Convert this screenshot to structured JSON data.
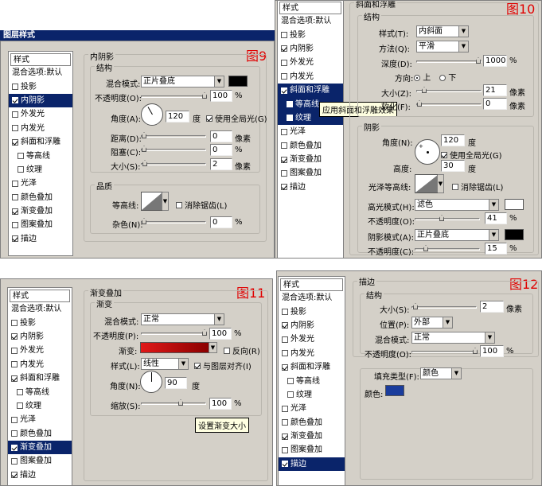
{
  "fig9": {
    "window_title": "图层样式",
    "figure_label": "图9",
    "side": {
      "header": "样式",
      "items": [
        {
          "label": "混合选项:默认",
          "cb": null,
          "on": false,
          "sub": false,
          "sel": false
        },
        {
          "label": "投影",
          "cb": true,
          "on": false,
          "sub": false,
          "sel": false
        },
        {
          "label": "内阴影",
          "cb": true,
          "on": true,
          "sub": false,
          "sel": true
        },
        {
          "label": "外发光",
          "cb": true,
          "on": false,
          "sub": false,
          "sel": false
        },
        {
          "label": "内发光",
          "cb": true,
          "on": false,
          "sub": false,
          "sel": false
        },
        {
          "label": "斜面和浮雕",
          "cb": true,
          "on": true,
          "sub": false,
          "sel": false
        },
        {
          "label": "等高线",
          "cb": true,
          "on": false,
          "sub": true,
          "sel": false
        },
        {
          "label": "纹理",
          "cb": true,
          "on": false,
          "sub": true,
          "sel": false
        },
        {
          "label": "光泽",
          "cb": true,
          "on": false,
          "sub": false,
          "sel": false
        },
        {
          "label": "颜色叠加",
          "cb": true,
          "on": false,
          "sub": false,
          "sel": false
        },
        {
          "label": "渐变叠加",
          "cb": true,
          "on": true,
          "sub": false,
          "sel": false
        },
        {
          "label": "图案叠加",
          "cb": true,
          "on": false,
          "sub": false,
          "sel": false
        },
        {
          "label": "描边",
          "cb": true,
          "on": true,
          "sub": false,
          "sel": false
        }
      ]
    },
    "section_title": "内阴影",
    "structure_title": "结构",
    "blend_mode_label": "混合模式:",
    "blend_mode_value": "正片叠底",
    "shadow_color": "#000000",
    "opacity_label": "不透明度(O):",
    "opacity_value": "100",
    "angle_label": "角度(A):",
    "angle_value": "120",
    "degree_unit": "度",
    "global_light_label": "使用全局光(G)",
    "distance_label": "距离(D):",
    "distance_value": "0",
    "choke_label": "阻塞(C):",
    "choke_value": "0",
    "size_label": "大小(S):",
    "size_value": "2",
    "px_unit": "像素",
    "pct_unit": "%",
    "quality_title": "品质",
    "contour_label": "等高线:",
    "antialias_label": "消除锯齿(L)",
    "noise_label": "杂色(N):",
    "noise_value": "0"
  },
  "fig10": {
    "figure_label": "图10",
    "section_title": "斜面和浮雕",
    "structure_title": "结构",
    "side": {
      "header": "样式",
      "items": [
        {
          "label": "混合选项:默认",
          "cb": null,
          "on": false,
          "sub": false,
          "sel": false
        },
        {
          "label": "投影",
          "cb": true,
          "on": false,
          "sub": false,
          "sel": false
        },
        {
          "label": "内阴影",
          "cb": true,
          "on": true,
          "sub": false,
          "sel": false
        },
        {
          "label": "外发光",
          "cb": true,
          "on": false,
          "sub": false,
          "sel": false
        },
        {
          "label": "内发光",
          "cb": true,
          "on": false,
          "sub": false,
          "sel": false
        },
        {
          "label": "斜面和浮雕",
          "cb": true,
          "on": true,
          "sub": false,
          "sel": true
        },
        {
          "label": "等高线",
          "cb": true,
          "on": false,
          "sub": true,
          "sel": true
        },
        {
          "label": "纹理",
          "cb": true,
          "on": false,
          "sub": true,
          "sel": true
        },
        {
          "label": "光泽",
          "cb": true,
          "on": false,
          "sub": false,
          "sel": false
        },
        {
          "label": "颜色叠加",
          "cb": true,
          "on": false,
          "sub": false,
          "sel": false
        },
        {
          "label": "渐变叠加",
          "cb": true,
          "on": true,
          "sub": false,
          "sel": false
        },
        {
          "label": "图案叠加",
          "cb": true,
          "on": false,
          "sub": false,
          "sel": false
        },
        {
          "label": "描边",
          "cb": true,
          "on": true,
          "sub": false,
          "sel": false
        }
      ]
    },
    "tooltip": "应用斜面和浮雕效果",
    "style_label": "样式(T):",
    "style_value": "内斜面",
    "technique_label": "方法(Q):",
    "technique_value": "平滑",
    "depth_label": "深度(D):",
    "depth_value": "1000",
    "direction_label": "方向:",
    "dir_up": "上",
    "dir_down": "下",
    "size_label": "大小(Z):",
    "size_value": "21",
    "soften_label": "软化(F):",
    "soften_value": "0",
    "px_unit": "像素",
    "pct_unit": "%",
    "shading_title": "阴影",
    "angle_label": "角度(N):",
    "angle_value": "120",
    "degree_unit": "度",
    "global_light_label": "使用全局光(G)",
    "altitude_label": "高度:",
    "altitude_value": "30",
    "gloss_label": "光泽等高线:",
    "antialias_label": "消除锯齿(L)",
    "highlight_label": "高光模式(H):",
    "highlight_value": "滤色",
    "highlight_color": "#ffffff",
    "hl_opacity_label": "不透明度(O):",
    "hl_opacity_value": "41",
    "shadow_mode_label": "阴影模式(A):",
    "shadow_mode_value": "正片叠底",
    "shadow_color": "#000000",
    "sh_opacity_label": "不透明度(C):",
    "sh_opacity_value": "15"
  },
  "fig11": {
    "figure_label": "图11",
    "section_title": "渐变叠加",
    "subsection_title": "渐变",
    "side": {
      "header": "样式",
      "items": [
        {
          "label": "混合选项:默认",
          "cb": null,
          "on": false,
          "sub": false,
          "sel": false
        },
        {
          "label": "投影",
          "cb": true,
          "on": false,
          "sub": false,
          "sel": false
        },
        {
          "label": "内阴影",
          "cb": true,
          "on": true,
          "sub": false,
          "sel": false
        },
        {
          "label": "外发光",
          "cb": true,
          "on": false,
          "sub": false,
          "sel": false
        },
        {
          "label": "内发光",
          "cb": true,
          "on": false,
          "sub": false,
          "sel": false
        },
        {
          "label": "斜面和浮雕",
          "cb": true,
          "on": true,
          "sub": false,
          "sel": false
        },
        {
          "label": "等高线",
          "cb": true,
          "on": false,
          "sub": true,
          "sel": false
        },
        {
          "label": "纹理",
          "cb": true,
          "on": false,
          "sub": true,
          "sel": false
        },
        {
          "label": "光泽",
          "cb": true,
          "on": false,
          "sub": false,
          "sel": false
        },
        {
          "label": "颜色叠加",
          "cb": true,
          "on": false,
          "sub": false,
          "sel": false
        },
        {
          "label": "渐变叠加",
          "cb": true,
          "on": true,
          "sub": false,
          "sel": true
        },
        {
          "label": "图案叠加",
          "cb": true,
          "on": false,
          "sub": false,
          "sel": false
        },
        {
          "label": "描边",
          "cb": true,
          "on": true,
          "sub": false,
          "sel": false
        }
      ]
    },
    "blend_mode_label": "混合模式:",
    "blend_mode_value": "正常",
    "opacity_label": "不透明度(P):",
    "opacity_value": "100",
    "gradient_label": "渐变:",
    "gradient_start": "#e01818",
    "gradient_end": "#8a0000",
    "reverse_label": "反向(R)",
    "style_label": "样式(L):",
    "style_value": "线性",
    "align_label": "与图层对齐(I)",
    "angle_label": "角度(N):",
    "angle_value": "90",
    "degree_unit": "度",
    "scale_label": "缩放(S):",
    "scale_value": "100",
    "pct_unit": "%",
    "tooltip": "设置渐变大小"
  },
  "fig12": {
    "figure_label": "图12",
    "section_title": "描边",
    "structure_title": "结构",
    "side": {
      "header": "样式",
      "items": [
        {
          "label": "混合选项:默认",
          "cb": null,
          "on": false,
          "sub": false,
          "sel": false
        },
        {
          "label": "投影",
          "cb": true,
          "on": false,
          "sub": false,
          "sel": false
        },
        {
          "label": "内阴影",
          "cb": true,
          "on": true,
          "sub": false,
          "sel": false
        },
        {
          "label": "外发光",
          "cb": true,
          "on": false,
          "sub": false,
          "sel": false
        },
        {
          "label": "内发光",
          "cb": true,
          "on": false,
          "sub": false,
          "sel": false
        },
        {
          "label": "斜面和浮雕",
          "cb": true,
          "on": true,
          "sub": false,
          "sel": false
        },
        {
          "label": "等高线",
          "cb": true,
          "on": false,
          "sub": true,
          "sel": false
        },
        {
          "label": "纹理",
          "cb": true,
          "on": false,
          "sub": true,
          "sel": false
        },
        {
          "label": "光泽",
          "cb": true,
          "on": false,
          "sub": false,
          "sel": false
        },
        {
          "label": "颜色叠加",
          "cb": true,
          "on": false,
          "sub": false,
          "sel": false
        },
        {
          "label": "渐变叠加",
          "cb": true,
          "on": true,
          "sub": false,
          "sel": false
        },
        {
          "label": "图案叠加",
          "cb": true,
          "on": false,
          "sub": false,
          "sel": false
        },
        {
          "label": "描边",
          "cb": true,
          "on": true,
          "sub": false,
          "sel": true
        }
      ]
    },
    "size_label": "大小(S):",
    "size_value": "2",
    "px_unit": "像素",
    "position_label": "位置(P):",
    "position_value": "外部",
    "blend_mode_label": "混合模式:",
    "blend_mode_value": "正常",
    "opacity_label": "不透明度(O):",
    "opacity_value": "100",
    "pct_unit": "%",
    "fill_type_label": "填充类型(F):",
    "fill_type_value": "颜色",
    "color_label": "颜色:",
    "stroke_color": "#1a3c9c"
  }
}
